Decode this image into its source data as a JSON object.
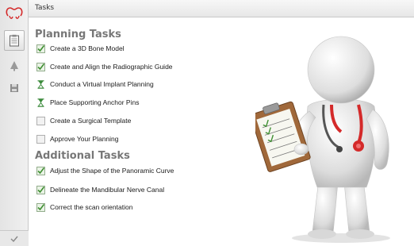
{
  "header": {
    "title": "Tasks"
  },
  "colors": {
    "accent_red": "#d42a2a",
    "check_green": "#4a9a3a",
    "hourglass_green": "#3a8a3a",
    "section_gray": "#777777"
  },
  "sections": [
    {
      "title": "Planning Tasks",
      "tasks": [
        {
          "label": "Create a 3D Bone Model",
          "status": "done",
          "icon": "check-icon"
        },
        {
          "label": "Create and Align the Radiographic Guide",
          "status": "done",
          "icon": "check-icon"
        },
        {
          "label": "Conduct a Virtual Implant Planning",
          "status": "in-progress",
          "icon": "hourglass-icon"
        },
        {
          "label": "Place Supporting Anchor Pins",
          "status": "in-progress",
          "icon": "hourglass-icon"
        },
        {
          "label": "Create a Surgical Template",
          "status": "pending",
          "icon": "empty-checkbox-icon"
        },
        {
          "label": "Approve Your Planning",
          "status": "pending",
          "icon": "empty-checkbox-icon"
        }
      ]
    },
    {
      "title": "Additional Tasks",
      "tasks": [
        {
          "label": "Adjust the Shape of the Panoramic Curve",
          "status": "done",
          "icon": "check-icon"
        },
        {
          "label": "Delineate the Mandibular Nerve Canal",
          "status": "done",
          "icon": "check-icon"
        },
        {
          "label": "Correct the scan orientation",
          "status": "done",
          "icon": "check-icon"
        }
      ]
    }
  ],
  "sidebar": {
    "logo": "tooth-logo-icon",
    "items": [
      {
        "icon": "clipboard-icon",
        "active": true
      },
      {
        "icon": "implant-icon",
        "active": false
      },
      {
        "icon": "save-icon",
        "active": false
      }
    ],
    "bottom_icon": "checkmark-icon"
  },
  "illustration": {
    "icon": "doctor-with-clipboard-icon"
  }
}
